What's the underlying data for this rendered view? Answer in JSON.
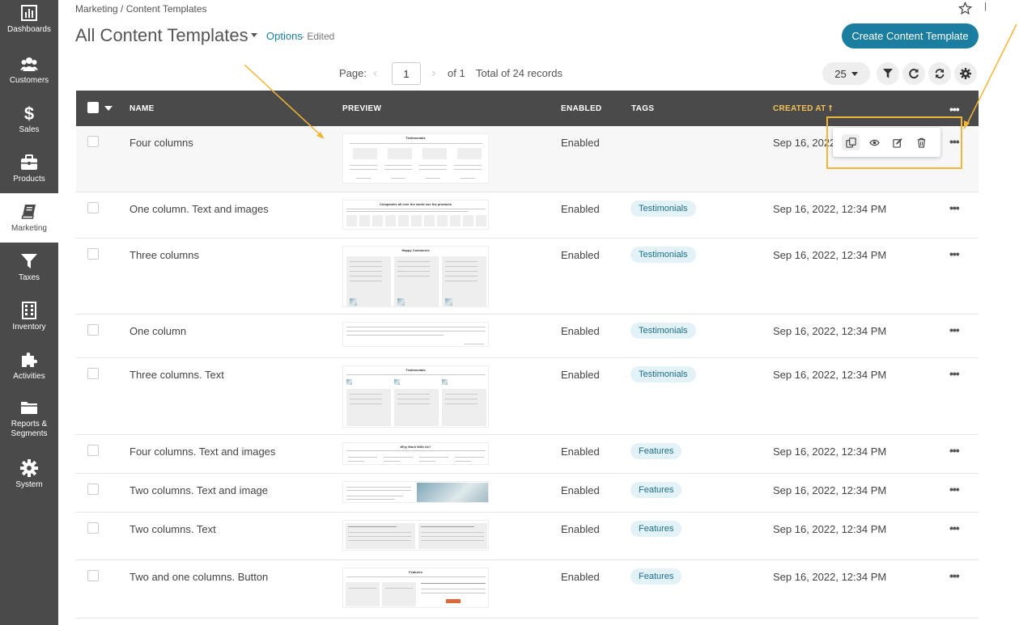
{
  "sidebar": {
    "items": [
      {
        "label": "Dashboards",
        "icon": "bar-chart-icon"
      },
      {
        "label": "Customers",
        "icon": "users-icon"
      },
      {
        "label": "Sales",
        "icon": "dollar-icon"
      },
      {
        "label": "Products",
        "icon": "briefcase-icon"
      },
      {
        "label": "Marketing",
        "icon": "book-icon"
      },
      {
        "label": "Taxes",
        "icon": "funnel-icon"
      },
      {
        "label": "Inventory",
        "icon": "building-icon"
      },
      {
        "label": "Activities",
        "icon": "puzzle-icon"
      },
      {
        "label": "Reports &\nSegments",
        "icon": "folder-icon"
      },
      {
        "label": "System",
        "icon": "gear-icon"
      }
    ]
  },
  "header": {
    "breadcrumb": "Marketing / Content Templates",
    "title": "All Content Templates",
    "options_label": "Options",
    "edited_label": "- Edited",
    "create_button": "Create Content Template"
  },
  "pagination": {
    "page_label": "Page:",
    "current_page": "1",
    "of_label": "of 1",
    "total_label": "Total of 24 records",
    "per_page": "25"
  },
  "table": {
    "columns": {
      "name": "NAME",
      "preview": "PREVIEW",
      "enabled": "ENABLED",
      "tags": "TAGS",
      "created": "CREATED AT"
    },
    "rows": [
      {
        "name": "Four columns",
        "enabled": "Enabled",
        "tag": "",
        "created": "Sep 16, 2022",
        "preview_title": "Testimonials"
      },
      {
        "name": "One column. Text and images",
        "enabled": "Enabled",
        "tag": "Testimonials",
        "created": "Sep 16, 2022, 12:34 PM",
        "preview_title": "Companies all over the world use the products"
      },
      {
        "name": "Three columns",
        "enabled": "Enabled",
        "tag": "Testimonials",
        "created": "Sep 16, 2022, 12:34 PM",
        "preview_title": "Happy Customers"
      },
      {
        "name": "One column",
        "enabled": "Enabled",
        "tag": "Testimonials",
        "created": "Sep 16, 2022, 12:34 PM",
        "preview_title": ""
      },
      {
        "name": "Three columns. Text",
        "enabled": "Enabled",
        "tag": "Testimonials",
        "created": "Sep 16, 2022, 12:34 PM",
        "preview_title": "Testimonials"
      },
      {
        "name": "Four columns. Text and images",
        "enabled": "Enabled",
        "tag": "Features",
        "created": "Sep 16, 2022, 12:34 PM",
        "preview_title": "Why Work With Us?"
      },
      {
        "name": "Two columns. Text and image",
        "enabled": "Enabled",
        "tag": "Features",
        "created": "Sep 16, 2022, 12:34 PM",
        "preview_title": ""
      },
      {
        "name": "Two columns. Text",
        "enabled": "Enabled",
        "tag": "Features",
        "created": "Sep 16, 2022, 12:34 PM",
        "preview_title": ""
      },
      {
        "name": "Two and one columns. Button",
        "enabled": "Enabled",
        "tag": "Features",
        "created": "Sep 16, 2022, 12:34 PM",
        "preview_title": "Features"
      }
    ]
  },
  "row_actions": [
    "duplicate-icon",
    "eye-icon",
    "edit-icon",
    "trash-icon"
  ],
  "colors": {
    "sidebar_bg": "#4a4a4a",
    "accent": "#1b7ea0",
    "sorted_header": "#f2c05a",
    "annotation": "#f2b535",
    "tag_bg": "#e3f2f7"
  }
}
